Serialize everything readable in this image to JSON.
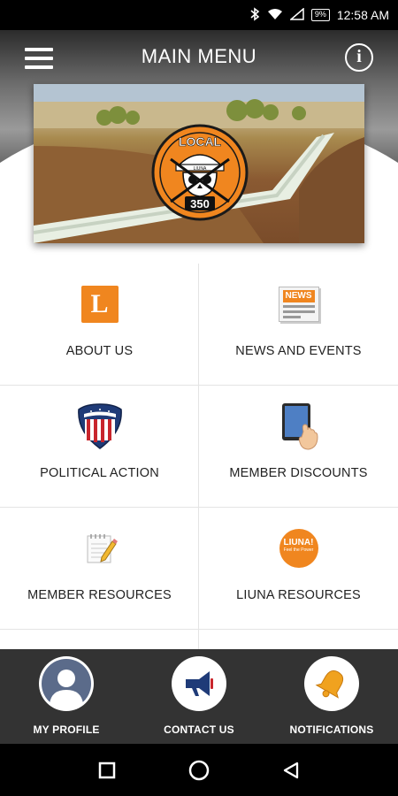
{
  "status_bar": {
    "icons": [
      "bluetooth-icon",
      "wifi-icon",
      "signal-icon",
      "battery-icon"
    ],
    "battery": "9%",
    "time": "12:58 AM"
  },
  "header": {
    "title": "MAIN MENU",
    "menu_icon": "hamburger-icon",
    "info_icon": "info-icon",
    "info_glyph": "i"
  },
  "hero": {
    "logo_text_top": "LOCAL",
    "logo_text_bottom": "350",
    "logo_band_text": "LIUNA"
  },
  "menu": [
    {
      "label": "ABOUT US",
      "icon": "letter-l-icon",
      "glyph": "L"
    },
    {
      "label": "NEWS AND EVENTS",
      "icon": "newspaper-icon",
      "glyph": "NEWS"
    },
    {
      "label": "POLITICAL ACTION",
      "icon": "flag-shield-icon"
    },
    {
      "label": "MEMBER DISCOUNTS",
      "icon": "tablet-touch-icon"
    },
    {
      "label": "MEMBER RESOURCES",
      "icon": "notepad-pencil-icon"
    },
    {
      "label": "LIUNA RESOURCES",
      "icon": "liuna-badge-icon",
      "glyph": "LIUNA!",
      "sub": "Feel the Power"
    }
  ],
  "bottom_nav": [
    {
      "label": "MY PROFILE",
      "icon": "user-icon"
    },
    {
      "label": "CONTACT US",
      "icon": "megaphone-icon"
    },
    {
      "label": "NOTIFICATIONS",
      "icon": "bell-icon"
    }
  ],
  "colors": {
    "accent_orange": "#f0861f",
    "bottom_bar": "#333333",
    "status_bar": "#000000"
  }
}
